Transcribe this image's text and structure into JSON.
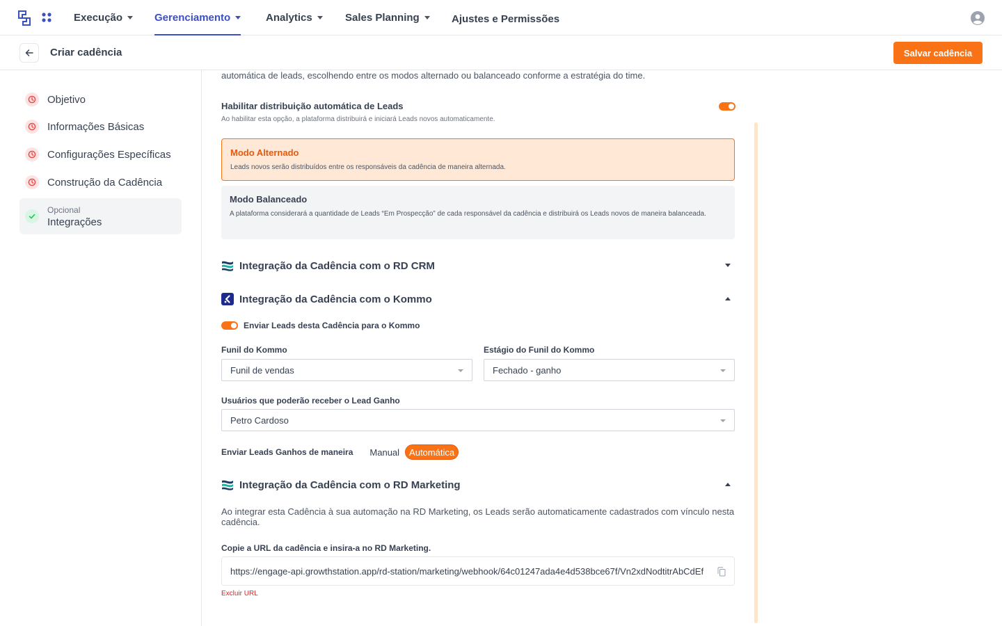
{
  "nav": {
    "items": [
      {
        "label": "Execução",
        "has_menu": true
      },
      {
        "label": "Gerenciamento",
        "has_menu": true,
        "active": true
      },
      {
        "label": "Analytics",
        "has_menu": true
      },
      {
        "label": "Sales Planning",
        "has_menu": true
      },
      {
        "label": "Ajustes e Permissões",
        "has_menu": false
      }
    ]
  },
  "header": {
    "title": "Criar cadência",
    "save_label": "Salvar cadência"
  },
  "sidebar": {
    "steps": [
      {
        "label": "Objetivo",
        "status": "pending"
      },
      {
        "label": "Informações Básicas",
        "status": "pending"
      },
      {
        "label": "Configurações Específicas",
        "status": "pending"
      },
      {
        "label": "Construção da Cadência",
        "status": "pending"
      },
      {
        "label": "Integrações",
        "sublabel": "Opcional",
        "status": "done"
      }
    ]
  },
  "distribution": {
    "intro_text": "automática de leads, escolhendo entre os modos alternado ou balanceado conforme a estratégia do time.",
    "toggle_title": "Habilitar distribuição automática de Leads",
    "toggle_desc": "Ao habilitar esta opção, a plataforma distribuirá e iniciará Leads novos automaticamente.",
    "enabled": true,
    "modes": [
      {
        "title": "Modo Alternado",
        "desc": "Leads novos serão distribuídos entre os responsáveis da cadência de maneira alternada.",
        "selected": true
      },
      {
        "title": "Modo Balanceado",
        "desc": "A plataforma considerará a quantidade de Leads “Em Prospecção” de cada responsável da cadência e distribuirá os Leads novos de maneira balanceada.",
        "selected": false
      }
    ]
  },
  "integrations": {
    "rd_crm": {
      "title": "Integração da Cadência com o RD CRM",
      "expanded": false
    },
    "kommo": {
      "title": "Integração da Cadência com o Kommo",
      "expanded": true,
      "toggle_label": "Enviar Leads desta Cadência para o Kommo",
      "toggle_on": true,
      "funnel_label": "Funil do Kommo",
      "funnel_value": "Funil de vendas",
      "stage_label": "Estágio do Funil do Kommo",
      "stage_value": "Fechado - ganho",
      "users_label": "Usuários que poderão receber o Lead Ganho",
      "users_value": "Petro Cardoso",
      "send_mode_label": "Enviar Leads Ganhos de maneira",
      "send_mode_manual": "Manual",
      "send_mode_auto": "Automática",
      "send_mode_selected": "Automática"
    },
    "rd_marketing": {
      "title": "Integração da Cadência com o RD Marketing",
      "expanded": true,
      "desc": "Ao integrar esta Cadência à sua automação na RD Marketing, os Leads serão automaticamente cadastrados com vínculo nesta cadência.",
      "url_label": "Copie a URL da cadência e insira-a no RD Marketing.",
      "url_value": "https://engage-api.growthstation.app/rd-station/marketing/webhook/64c01247ada4e4d538bce67f/Vn2xdNodtitrAbCdEf",
      "delete_label": "Excluir URL"
    }
  },
  "colors": {
    "accent": "#f97316",
    "nav_active": "#3b4fc4",
    "pending": "#ef4444",
    "done": "#22c55e",
    "danger": "#dc2626"
  },
  "icons": [
    "logo-icon",
    "apps-grid-icon",
    "user-avatar-icon",
    "arrow-left-icon",
    "clock-icon",
    "check-icon",
    "rd-station-icon",
    "kommo-icon",
    "copy-icon"
  ]
}
